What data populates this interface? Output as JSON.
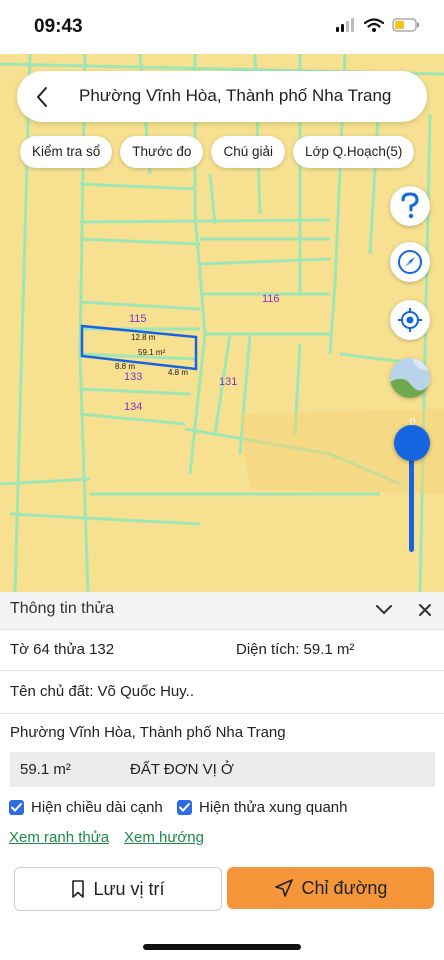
{
  "status_bar": {
    "time": "09:43"
  },
  "search": {
    "title": "Phường Vĩnh Hòa, Thành phố Nha Trang"
  },
  "chips": [
    {
      "label": "Kiểm tra sổ"
    },
    {
      "label": "Thước đo"
    },
    {
      "label": "Chú giải"
    },
    {
      "label": "Lớp Q.Hoạch(5)"
    }
  ],
  "map": {
    "plots": [
      "115",
      "116",
      "133",
      "131",
      "134"
    ],
    "selected": {
      "top_length": "12.8 m",
      "area": "59.1 m²",
      "left_length": "8.8 m",
      "right_length": "4.8 m"
    },
    "slider_top_label": "0"
  },
  "panel": {
    "title": "Thông tin thửa",
    "sheet_parcel": "Tờ 64 thửa 132",
    "area_label": "Diện tích: 59.1 m²",
    "owner": "Tên chủ đất: Võ Quốc Huy..",
    "address": "Phường Vĩnh Hòa, Thành phố Nha Trang",
    "land_area": "59.1 m²",
    "land_type": "ĐẤT ĐƠN VỊ Ở",
    "checkbox_edges": "Hiện chiều dài cạnh",
    "checkbox_neighbors": "Hiện thửa xung quanh",
    "link_boundary": "Xem ranh thửa",
    "link_direction": "Xem hướng",
    "save_label": "Lưu vị trí",
    "directions_label": "Chỉ đường"
  },
  "colors": {
    "accent_blue": "#1565e0",
    "primary_orange": "#f5963b",
    "link_green": "#1e8a4a",
    "map_fill": "#f7e08f",
    "plot_line": "#9ee6b5"
  }
}
